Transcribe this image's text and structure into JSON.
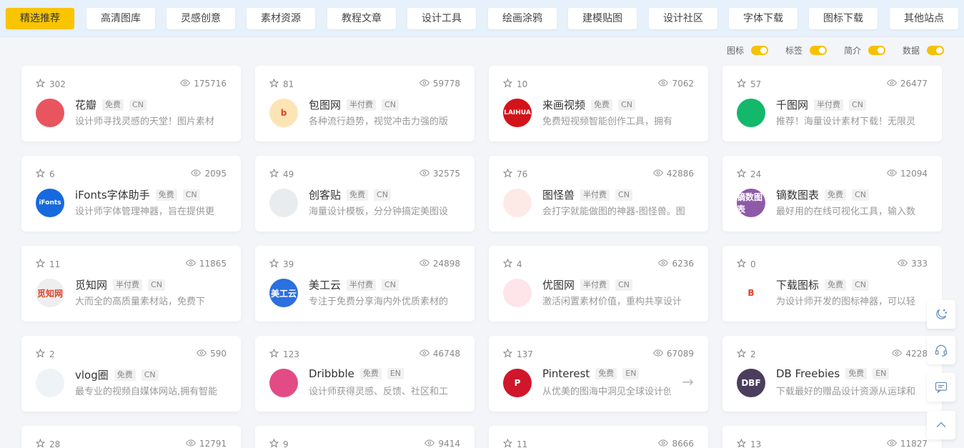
{
  "nav": {
    "tabs": [
      "精选推荐",
      "高清图库",
      "灵感创意",
      "素材资源",
      "教程文章",
      "设计工具",
      "绘画涂鸦",
      "建模贴图",
      "设计社区",
      "字体下载",
      "图标下载",
      "其他站点"
    ]
  },
  "toggles": [
    "图标",
    "标签",
    "简介",
    "数据"
  ],
  "cards": [
    {
      "stars": "302",
      "views": "175716",
      "name": "花瓣",
      "price": "免费",
      "lang": "CN",
      "desc": "设计师寻找灵感的天堂！图片素材",
      "logo": "",
      "color": "#e9555e"
    },
    {
      "stars": "81",
      "views": "59778",
      "name": "包图网",
      "price": "半付费",
      "lang": "CN",
      "desc": "各种流行趋势，视觉冲击力强的版",
      "logo": "b",
      "color": "#fde4b5"
    },
    {
      "stars": "10",
      "views": "7062",
      "name": "来画视频",
      "price": "免费",
      "lang": "CN",
      "desc": "免费短视频智能创作工具，拥有",
      "logo": "LAIHUA",
      "color": "#d3131a"
    },
    {
      "stars": "57",
      "views": "26477",
      "name": "千图网",
      "price": "半付费",
      "lang": "CN",
      "desc": "推荐！海量设计素材下载！无限灵",
      "logo": "",
      "color": "#14b86a"
    },
    {
      "stars": "6",
      "views": "2095",
      "name": "iFonts字体助手",
      "price": "免费",
      "lang": "CN",
      "desc": "设计师字体管理神器，旨在提供更",
      "logo": "iFonts",
      "color": "#1769e0"
    },
    {
      "stars": "49",
      "views": "32575",
      "name": "创客贴",
      "price": "免费",
      "lang": "CN",
      "desc": "海量设计模板，分分钟搞定美图设",
      "logo": "",
      "color": "#e9ecef"
    },
    {
      "stars": "76",
      "views": "42886",
      "name": "图怪兽",
      "price": "半付费",
      "lang": "CN",
      "desc": "会打字就能做图的神器-图怪兽。图",
      "logo": "",
      "color": "#fdeae6"
    },
    {
      "stars": "24",
      "views": "12094",
      "name": "镝数图表",
      "price": "免费",
      "lang": "CN",
      "desc": "最好用的在线可视化工具，输入数",
      "logo": "镝数图表",
      "color": "#8e5aa8"
    },
    {
      "stars": "11",
      "views": "11865",
      "name": "觅知网",
      "price": "半付费",
      "lang": "CN",
      "desc": "大而全的高质量素材站，免费下",
      "logo": "觅知网",
      "color": "#eeeeee"
    },
    {
      "stars": "39",
      "views": "24898",
      "name": "美工云",
      "price": "半付费",
      "lang": "CN",
      "desc": "专注于免费分享海内外优质素材的",
      "logo": "美工云",
      "color": "#2b6fe0"
    },
    {
      "stars": "4",
      "views": "6236",
      "name": "优图网",
      "price": "半付费",
      "lang": "CN",
      "desc": "激活闲置素材价值，重构共享设计",
      "logo": "",
      "color": "#fde5ea"
    },
    {
      "stars": "0",
      "views": "333",
      "name": "下载图标",
      "price": "免费",
      "lang": "CN",
      "desc": "为设计师开发的图标神器，可以轻",
      "logo": "B",
      "color": "#ffffff"
    },
    {
      "stars": "2",
      "views": "590",
      "name": "vlog圈",
      "price": "免费",
      "lang": "CN",
      "desc": "最专业的视频自媒体网站,拥有智能",
      "logo": "",
      "color": "#eef3f7"
    },
    {
      "stars": "123",
      "views": "46748",
      "name": "Dribbble",
      "price": "免费",
      "lang": "EN",
      "desc": "设计师获得灵感、反馈、社区和工",
      "logo": "",
      "color": "#e34b86"
    },
    {
      "stars": "137",
      "views": "67089",
      "name": "Pinterest",
      "price": "免费",
      "lang": "EN",
      "desc": "从优美的图海中洞见全球设计创",
      "logo": "P",
      "color": "#d0162a"
    },
    {
      "stars": "2",
      "views": "4228",
      "name": "DB Freebies",
      "price": "免费",
      "lang": "EN",
      "desc": "下载最好的赠品设计资源从运球和",
      "logo": "DBF",
      "color": "#4a3d5e"
    }
  ],
  "partial_cards": [
    {
      "stars": "28",
      "views": "12791"
    },
    {
      "stars": "9",
      "views": "9414"
    },
    {
      "stars": "11",
      "views": "8666"
    },
    {
      "stars": "13",
      "views": "11827"
    }
  ],
  "side_buttons": [
    "theme-moon-icon",
    "customer-service-icon",
    "comment-icon",
    "back-to-top-icon"
  ]
}
